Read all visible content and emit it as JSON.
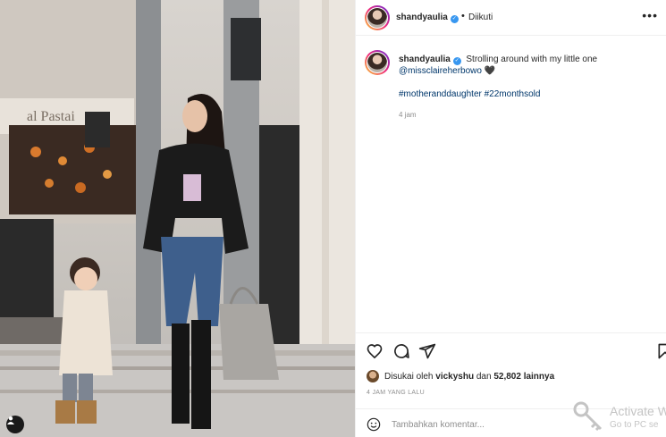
{
  "post": {
    "username": "shandyaulia",
    "follow_separator": "•",
    "follow_status": "Diikuti",
    "more_label": "•••"
  },
  "caption": {
    "username": "shandyaulia",
    "text": "Strolling around with my little one",
    "mention": "@missclaireherbowo",
    "heart": "🖤",
    "hashtags": "#motheranddaughter #22monthsold",
    "time": "4 jam"
  },
  "likes": {
    "prefix": "Disukai oleh",
    "user": "vickyshu",
    "middle": "dan",
    "count_text": "52,802 lainnya"
  },
  "post_time": "4 JAM YANG LALU",
  "comment": {
    "placeholder": "Tambahkan komentar..."
  },
  "watermark": {
    "title": "Activate W",
    "subtitle": "Go to PC se"
  },
  "colors": {
    "link": "#00376b",
    "verified": "#3897f0",
    "muted": "#8e8e8e",
    "text": "#262626"
  },
  "icons": {
    "verified": "verified-badge-icon",
    "like": "heart-icon",
    "comment": "comment-icon",
    "share": "send-icon",
    "save": "bookmark-icon",
    "emoji": "emoji-icon",
    "more": "more-options-icon",
    "tagged": "user-tag-icon",
    "key": "key-icon"
  }
}
